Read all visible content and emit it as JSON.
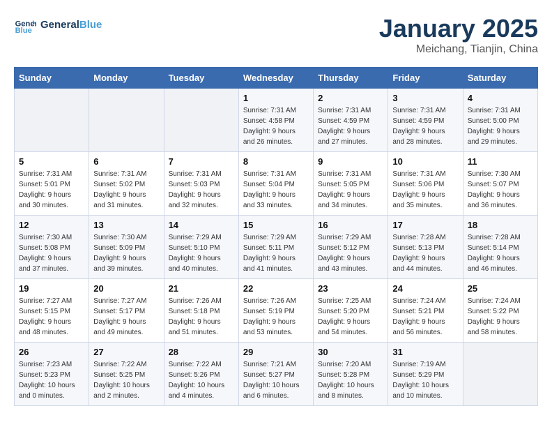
{
  "header": {
    "logo_line1": "General",
    "logo_line2": "Blue",
    "title": "January 2025",
    "subtitle": "Meichang, Tianjin, China"
  },
  "weekdays": [
    "Sunday",
    "Monday",
    "Tuesday",
    "Wednesday",
    "Thursday",
    "Friday",
    "Saturday"
  ],
  "weeks": [
    [
      {
        "day": "",
        "empty": true
      },
      {
        "day": "",
        "empty": true
      },
      {
        "day": "",
        "empty": true
      },
      {
        "day": "1",
        "sunrise": "7:31 AM",
        "sunset": "4:58 PM",
        "daylight": "9 hours and 26 minutes."
      },
      {
        "day": "2",
        "sunrise": "7:31 AM",
        "sunset": "4:59 PM",
        "daylight": "9 hours and 27 minutes."
      },
      {
        "day": "3",
        "sunrise": "7:31 AM",
        "sunset": "4:59 PM",
        "daylight": "9 hours and 28 minutes."
      },
      {
        "day": "4",
        "sunrise": "7:31 AM",
        "sunset": "5:00 PM",
        "daylight": "9 hours and 29 minutes."
      }
    ],
    [
      {
        "day": "5",
        "sunrise": "7:31 AM",
        "sunset": "5:01 PM",
        "daylight": "9 hours and 30 minutes."
      },
      {
        "day": "6",
        "sunrise": "7:31 AM",
        "sunset": "5:02 PM",
        "daylight": "9 hours and 31 minutes."
      },
      {
        "day": "7",
        "sunrise": "7:31 AM",
        "sunset": "5:03 PM",
        "daylight": "9 hours and 32 minutes."
      },
      {
        "day": "8",
        "sunrise": "7:31 AM",
        "sunset": "5:04 PM",
        "daylight": "9 hours and 33 minutes."
      },
      {
        "day": "9",
        "sunrise": "7:31 AM",
        "sunset": "5:05 PM",
        "daylight": "9 hours and 34 minutes."
      },
      {
        "day": "10",
        "sunrise": "7:31 AM",
        "sunset": "5:06 PM",
        "daylight": "9 hours and 35 minutes."
      },
      {
        "day": "11",
        "sunrise": "7:30 AM",
        "sunset": "5:07 PM",
        "daylight": "9 hours and 36 minutes."
      }
    ],
    [
      {
        "day": "12",
        "sunrise": "7:30 AM",
        "sunset": "5:08 PM",
        "daylight": "9 hours and 37 minutes."
      },
      {
        "day": "13",
        "sunrise": "7:30 AM",
        "sunset": "5:09 PM",
        "daylight": "9 hours and 39 minutes."
      },
      {
        "day": "14",
        "sunrise": "7:29 AM",
        "sunset": "5:10 PM",
        "daylight": "9 hours and 40 minutes."
      },
      {
        "day": "15",
        "sunrise": "7:29 AM",
        "sunset": "5:11 PM",
        "daylight": "9 hours and 41 minutes."
      },
      {
        "day": "16",
        "sunrise": "7:29 AM",
        "sunset": "5:12 PM",
        "daylight": "9 hours and 43 minutes."
      },
      {
        "day": "17",
        "sunrise": "7:28 AM",
        "sunset": "5:13 PM",
        "daylight": "9 hours and 44 minutes."
      },
      {
        "day": "18",
        "sunrise": "7:28 AM",
        "sunset": "5:14 PM",
        "daylight": "9 hours and 46 minutes."
      }
    ],
    [
      {
        "day": "19",
        "sunrise": "7:27 AM",
        "sunset": "5:15 PM",
        "daylight": "9 hours and 48 minutes."
      },
      {
        "day": "20",
        "sunrise": "7:27 AM",
        "sunset": "5:17 PM",
        "daylight": "9 hours and 49 minutes."
      },
      {
        "day": "21",
        "sunrise": "7:26 AM",
        "sunset": "5:18 PM",
        "daylight": "9 hours and 51 minutes."
      },
      {
        "day": "22",
        "sunrise": "7:26 AM",
        "sunset": "5:19 PM",
        "daylight": "9 hours and 53 minutes."
      },
      {
        "day": "23",
        "sunrise": "7:25 AM",
        "sunset": "5:20 PM",
        "daylight": "9 hours and 54 minutes."
      },
      {
        "day": "24",
        "sunrise": "7:24 AM",
        "sunset": "5:21 PM",
        "daylight": "9 hours and 56 minutes."
      },
      {
        "day": "25",
        "sunrise": "7:24 AM",
        "sunset": "5:22 PM",
        "daylight": "9 hours and 58 minutes."
      }
    ],
    [
      {
        "day": "26",
        "sunrise": "7:23 AM",
        "sunset": "5:23 PM",
        "daylight": "10 hours and 0 minutes."
      },
      {
        "day": "27",
        "sunrise": "7:22 AM",
        "sunset": "5:25 PM",
        "daylight": "10 hours and 2 minutes."
      },
      {
        "day": "28",
        "sunrise": "7:22 AM",
        "sunset": "5:26 PM",
        "daylight": "10 hours and 4 minutes."
      },
      {
        "day": "29",
        "sunrise": "7:21 AM",
        "sunset": "5:27 PM",
        "daylight": "10 hours and 6 minutes."
      },
      {
        "day": "30",
        "sunrise": "7:20 AM",
        "sunset": "5:28 PM",
        "daylight": "10 hours and 8 minutes."
      },
      {
        "day": "31",
        "sunrise": "7:19 AM",
        "sunset": "5:29 PM",
        "daylight": "10 hours and 10 minutes."
      },
      {
        "day": "",
        "empty": true
      }
    ]
  ]
}
